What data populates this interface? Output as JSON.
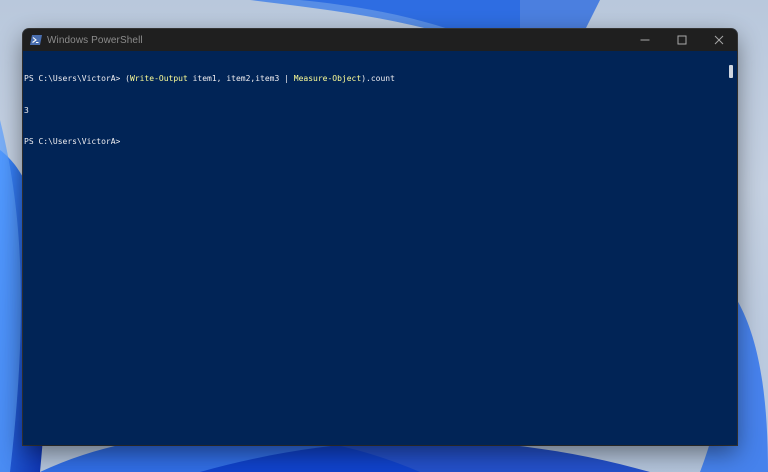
{
  "window": {
    "title": "Windows PowerShell",
    "icon": "powershell-icon"
  },
  "controls": {
    "minimize_icon": "minimize-icon",
    "maximize_icon": "maximize-icon",
    "close_icon": "close-icon"
  },
  "console": {
    "background": "#012456",
    "lines": [
      {
        "prompt": "PS C:\\Users\\VictorA> ",
        "paren_open": "(",
        "cmdlet1": "Write-Output",
        "args": " item1, item2,item3 | ",
        "cmdlet2": "Measure-Object",
        "tail": ").count"
      },
      {
        "output": "3"
      },
      {
        "prompt": "PS C:\\Users\\VictorA>"
      }
    ]
  },
  "colors": {
    "text": "#eeedf0",
    "cmdlet": "#fdfd96",
    "titlebar": "#1f1f1f"
  }
}
